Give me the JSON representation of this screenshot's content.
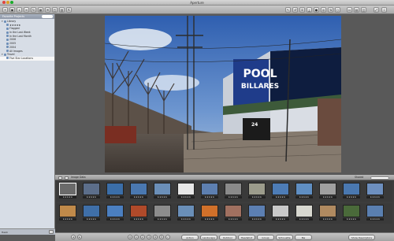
{
  "window": {
    "title": "Aperture"
  },
  "sidebar": {
    "header": "Favorite Projects",
    "items": [
      {
        "label": "Library",
        "indent": 0
      },
      {
        "label": "★★★★★",
        "indent": 1
      },
      {
        "label": "Flagged",
        "indent": 1
      },
      {
        "label": "In the Last Week",
        "indent": 1
      },
      {
        "label": "In the Last Month",
        "indent": 1
      },
      {
        "label": "2006",
        "indent": 1
      },
      {
        "label": "2005",
        "indent": 1
      },
      {
        "label": "2004",
        "indent": 1
      },
      {
        "label": "All Images",
        "indent": 1
      },
      {
        "label": "Travel",
        "indent": 0
      },
      {
        "label": "Five Star Locations",
        "indent": 1,
        "selected": true
      }
    ]
  },
  "browser_bar": {
    "label": "Image Data",
    "right_label": "Shared"
  },
  "photo": {
    "sign_line1": "POOL",
    "sign_line2": "BILLARES",
    "door_number": "24"
  },
  "filmstrip_rows": [
    [
      "#6a6a6a",
      "#5c6e8a",
      "#3b6ea8",
      "#4a78b0",
      "#6b8fb8",
      "#e8e8e8",
      "#5d7fb0",
      "#8a8a8a",
      "#9c9c8c",
      "#4d7cb6",
      "#5f8ec2",
      "#a0a0a0",
      "#4a78b0",
      "#6d8fbf"
    ],
    [
      "#c08a4a",
      "#3f6fa8",
      "#4b7fc0",
      "#b04a2a",
      "#8c8c8c",
      "#6a8fb8",
      "#d0702a",
      "#a07060",
      "#5c7fb2",
      "#c8c8c8",
      "#d8d8d0",
      "#b08a60",
      "#4a6a3a",
      "#5a7fb0"
    ]
  ],
  "thumb_rating": "★★★★★",
  "keyword_labels": {
    "top": [
      "Action",
      "Landscape",
      "Outdoor",
      "Headshot",
      "Group",
      "Silhouette",
      "Bw",
      "Show Descriptors"
    ],
    "bottom": [
      "Nature",
      "Studio",
      "Sports",
      "Full Body",
      "Unmounted",
      "Red Dot"
    ]
  },
  "status": {
    "left": "Hasti"
  }
}
